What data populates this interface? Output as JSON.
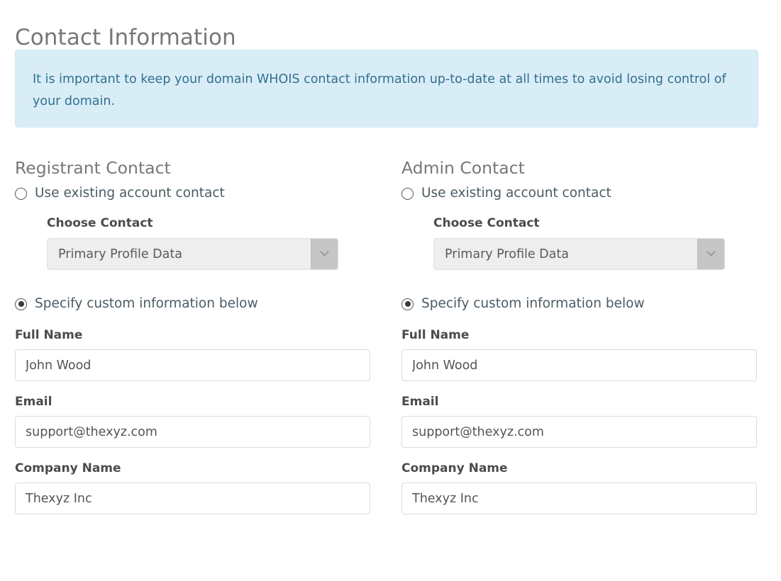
{
  "page": {
    "title": "Contact Information"
  },
  "alert": {
    "icon": "info-icon",
    "text": "It is important to keep your domain WHOIS contact information up-to-date at all times to avoid losing control of your domain.",
    "background_color": "#d9edf7",
    "text_color": "#31708f"
  },
  "radio_options": {
    "existing": "Use existing account contact",
    "custom": "Specify custom information below"
  },
  "labels": {
    "choose_contact": "Choose Contact",
    "full_name": "Full Name",
    "email": "Email",
    "company_name": "Company Name"
  },
  "columns": [
    {
      "key": "registrant",
      "heading": "Registrant Contact",
      "use_existing_selected": false,
      "use_custom_selected": true,
      "choose_contact": {
        "label": "Choose Contact",
        "selected": "Primary Profile Data",
        "options": [
          "Primary Profile Data"
        ]
      },
      "fields": {
        "full_name": {
          "label": "Full Name",
          "value": "John Wood",
          "placeholder": "Full Name"
        },
        "email": {
          "label": "Email",
          "value": "support@thexyz.com",
          "placeholder": "Email"
        },
        "company_name": {
          "label": "Company Name",
          "value": "Thexyz Inc",
          "placeholder": "Company Name"
        }
      }
    },
    {
      "key": "admin",
      "heading": "Admin Contact",
      "use_existing_selected": false,
      "use_custom_selected": true,
      "choose_contact": {
        "label": "Choose Contact",
        "selected": "Primary Profile Data",
        "options": [
          "Primary Profile Data"
        ]
      },
      "fields": {
        "full_name": {
          "label": "Full Name",
          "value": "John Wood",
          "placeholder": "Full Name"
        },
        "email": {
          "label": "Email",
          "value": "support@thexyz.com",
          "placeholder": "Email"
        },
        "company_name": {
          "label": "Company Name",
          "value": "Thexyz Inc",
          "placeholder": "Company Name"
        }
      }
    }
  ],
  "colors": {
    "heading": "#777777",
    "label": "#4b4b4b",
    "input_border": "#dcdcdc",
    "select_bg": "#eeeeee",
    "select_arrow_bg": "#c6c6c6"
  }
}
